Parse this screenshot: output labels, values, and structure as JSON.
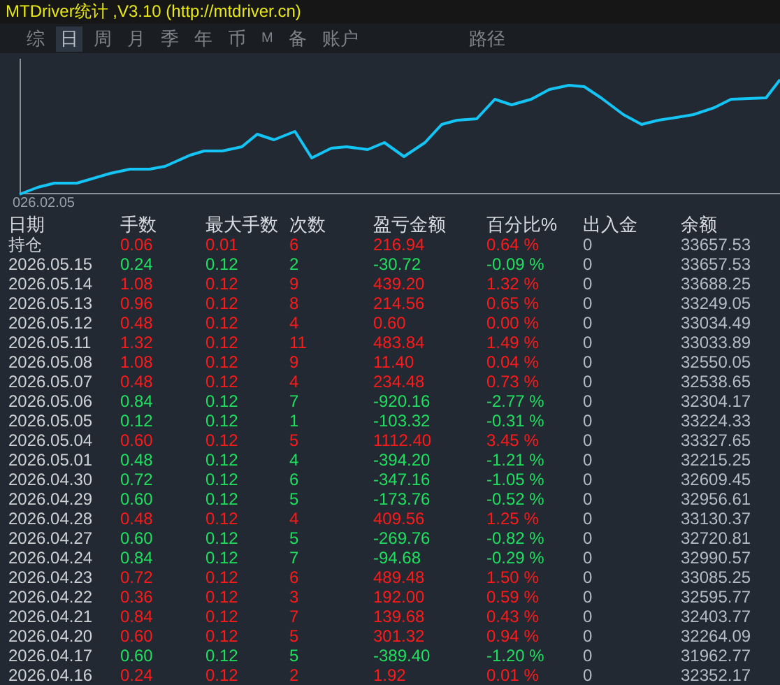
{
  "window": {
    "title": "MTDriver统计 ,V3.10 (http://mtdriver.cn)"
  },
  "tabs": [
    {
      "label": "综",
      "selected": false
    },
    {
      "label": "日",
      "selected": true
    },
    {
      "label": "周",
      "selected": false
    },
    {
      "label": "月",
      "selected": false
    },
    {
      "label": "季",
      "selected": false
    },
    {
      "label": "年",
      "selected": false
    },
    {
      "label": "币",
      "selected": false
    },
    {
      "label": "M",
      "selected": false
    },
    {
      "label": "备",
      "selected": false
    },
    {
      "label": "账户",
      "selected": false
    }
  ],
  "path_button": "路径",
  "chart": {
    "start_label": "026.02.05"
  },
  "table": {
    "columns": [
      "日期",
      "手数",
      "最大手数",
      "次数",
      "盈亏金额",
      "百分比%",
      "出入金",
      "余额"
    ],
    "rows": [
      {
        "kind": "gain",
        "cells": [
          "持仓",
          "0.06",
          "0.01",
          "6",
          "216.94",
          "0.64 %",
          "0",
          "33657.53"
        ]
      },
      {
        "kind": "loss",
        "cells": [
          "2026.05.15",
          "0.24",
          "0.12",
          "2",
          "-30.72",
          "-0.09 %",
          "0",
          "33657.53"
        ]
      },
      {
        "kind": "gain",
        "cells": [
          "2026.05.14",
          "1.08",
          "0.12",
          "9",
          "439.20",
          "1.32 %",
          "0",
          "33688.25"
        ]
      },
      {
        "kind": "gain",
        "cells": [
          "2026.05.13",
          "0.96",
          "0.12",
          "8",
          "214.56",
          "0.65 %",
          "0",
          "33249.05"
        ]
      },
      {
        "kind": "gain",
        "cells": [
          "2026.05.12",
          "0.48",
          "0.12",
          "4",
          "0.60",
          "0.00 %",
          "0",
          "33034.49"
        ]
      },
      {
        "kind": "gain",
        "cells": [
          "2026.05.11",
          "1.32",
          "0.12",
          "11",
          "483.84",
          "1.49 %",
          "0",
          "33033.89"
        ]
      },
      {
        "kind": "gain",
        "cells": [
          "2026.05.08",
          "1.08",
          "0.12",
          "9",
          "11.40",
          "0.04 %",
          "0",
          "32550.05"
        ]
      },
      {
        "kind": "gain",
        "cells": [
          "2026.05.07",
          "0.48",
          "0.12",
          "4",
          "234.48",
          "0.73 %",
          "0",
          "32538.65"
        ]
      },
      {
        "kind": "loss",
        "cells": [
          "2026.05.06",
          "0.84",
          "0.12",
          "7",
          "-920.16",
          "-2.77 %",
          "0",
          "32304.17"
        ]
      },
      {
        "kind": "loss",
        "cells": [
          "2026.05.05",
          "0.12",
          "0.12",
          "1",
          "-103.32",
          "-0.31 %",
          "0",
          "33224.33"
        ]
      },
      {
        "kind": "gain",
        "cells": [
          "2026.05.04",
          "0.60",
          "0.12",
          "5",
          "1112.40",
          "3.45 %",
          "0",
          "33327.65"
        ]
      },
      {
        "kind": "loss",
        "cells": [
          "2026.05.01",
          "0.48",
          "0.12",
          "4",
          "-394.20",
          "-1.21 %",
          "0",
          "32215.25"
        ]
      },
      {
        "kind": "loss",
        "cells": [
          "2026.04.30",
          "0.72",
          "0.12",
          "6",
          "-347.16",
          "-1.05 %",
          "0",
          "32609.45"
        ]
      },
      {
        "kind": "loss",
        "cells": [
          "2026.04.29",
          "0.60",
          "0.12",
          "5",
          "-173.76",
          "-0.52 %",
          "0",
          "32956.61"
        ]
      },
      {
        "kind": "gain",
        "cells": [
          "2026.04.28",
          "0.48",
          "0.12",
          "4",
          "409.56",
          "1.25 %",
          "0",
          "33130.37"
        ]
      },
      {
        "kind": "loss",
        "cells": [
          "2026.04.27",
          "0.60",
          "0.12",
          "5",
          "-269.76",
          "-0.82 %",
          "0",
          "32720.81"
        ]
      },
      {
        "kind": "loss",
        "cells": [
          "2026.04.24",
          "0.84",
          "0.12",
          "7",
          "-94.68",
          "-0.29 %",
          "0",
          "32990.57"
        ]
      },
      {
        "kind": "gain",
        "cells": [
          "2026.04.23",
          "0.72",
          "0.12",
          "6",
          "489.48",
          "1.50 %",
          "0",
          "33085.25"
        ]
      },
      {
        "kind": "gain",
        "cells": [
          "2026.04.22",
          "0.36",
          "0.12",
          "3",
          "192.00",
          "0.59 %",
          "0",
          "32595.77"
        ]
      },
      {
        "kind": "gain",
        "cells": [
          "2026.04.21",
          "0.84",
          "0.12",
          "7",
          "139.68",
          "0.43 %",
          "0",
          "32403.77"
        ]
      },
      {
        "kind": "gain",
        "cells": [
          "2026.04.20",
          "0.60",
          "0.12",
          "5",
          "301.32",
          "0.94 %",
          "0",
          "32264.09"
        ]
      },
      {
        "kind": "loss",
        "cells": [
          "2026.04.17",
          "0.60",
          "0.12",
          "5",
          "-389.40",
          "-1.20 %",
          "0",
          "31962.77"
        ]
      },
      {
        "kind": "gain",
        "cells": [
          "2026.04.16",
          "0.24",
          "0.12",
          "2",
          "1.92",
          "0.01 %",
          "0",
          "32352.17"
        ]
      }
    ]
  }
}
